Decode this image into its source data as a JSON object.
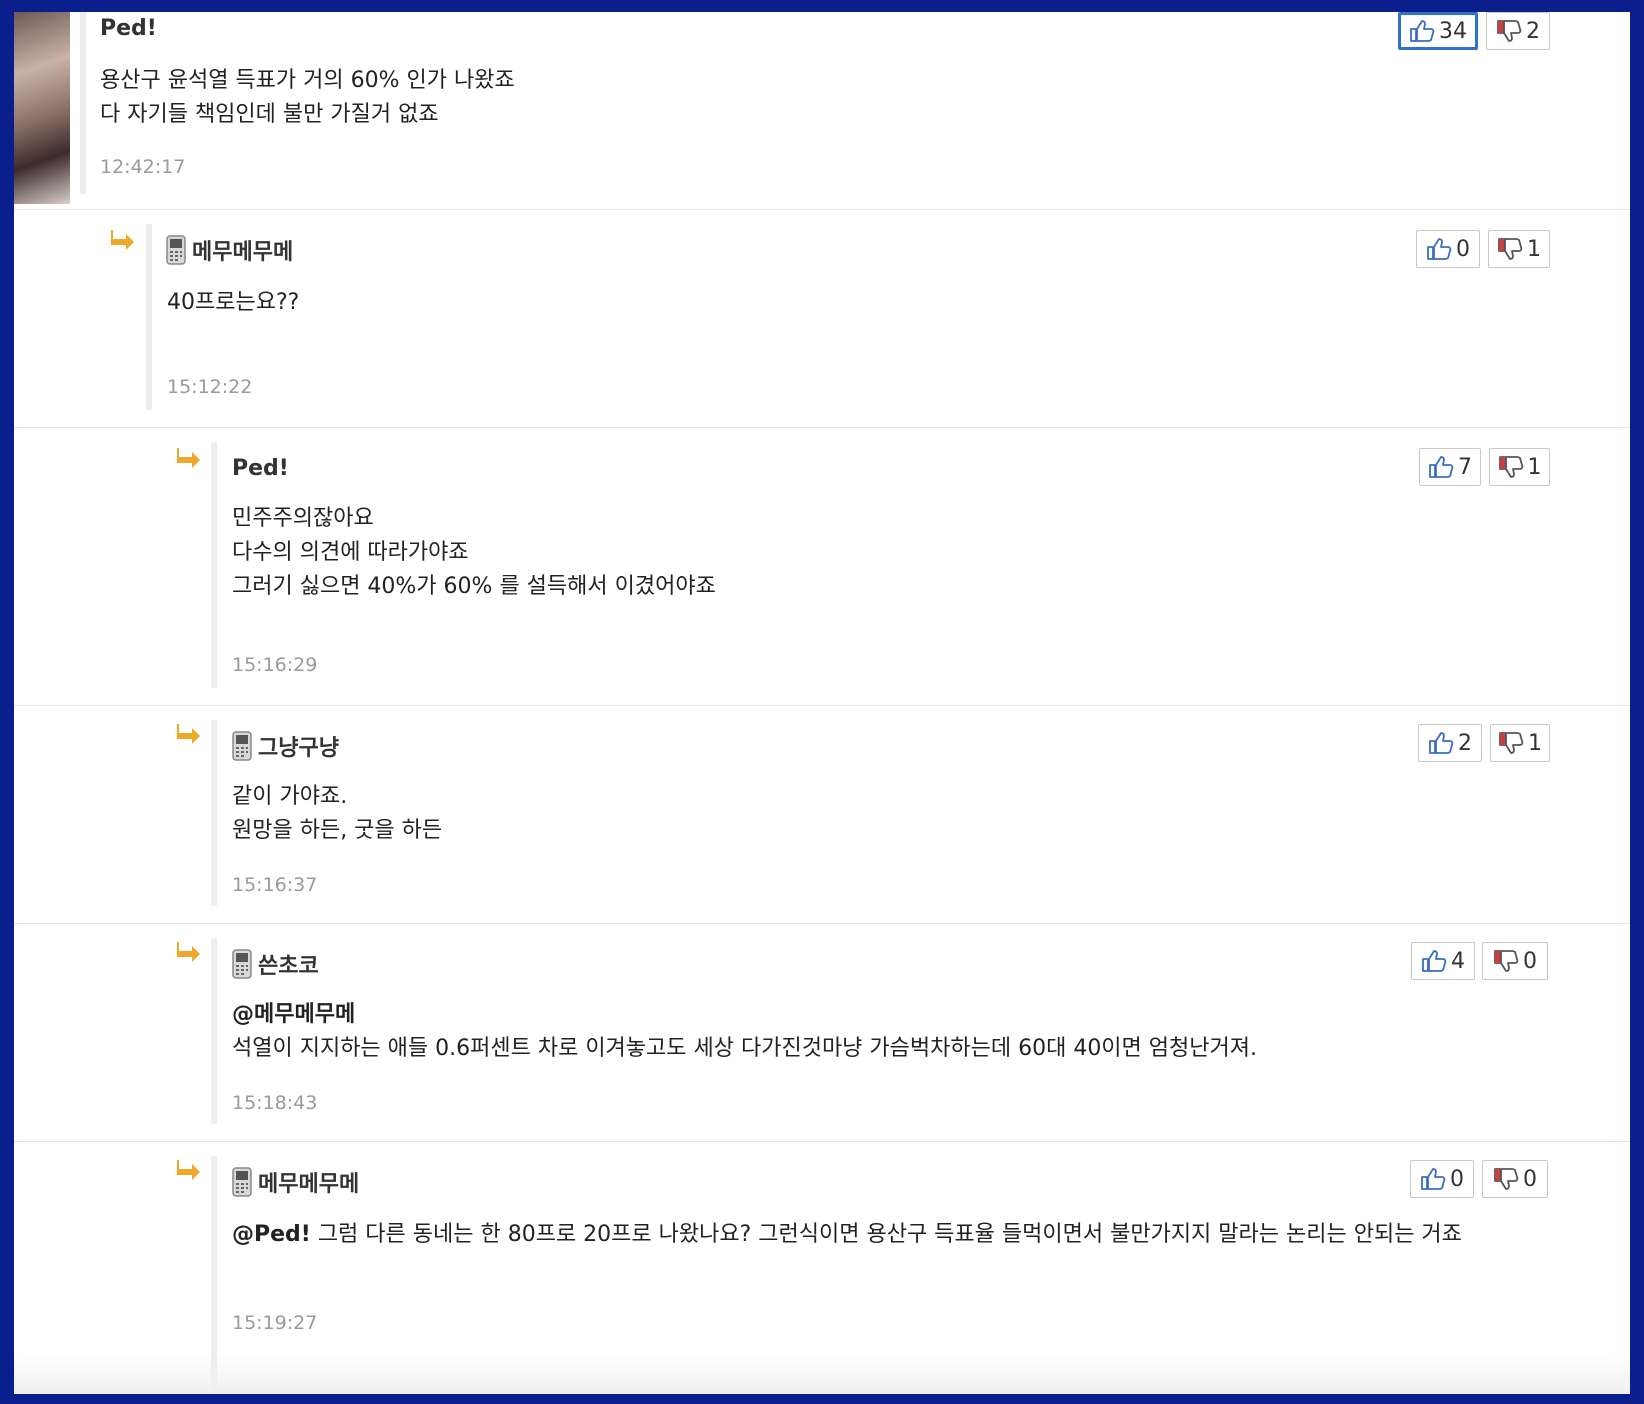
{
  "comments": [
    {
      "author": "Ped!",
      "lines": [
        "용산구 윤석열 득표가 거의 60% 인가 나왔죠",
        "다 자기들 책임인데 불만 가질거 없죠"
      ],
      "time": "12:42:17",
      "up": "34",
      "down": "2"
    },
    {
      "author": "메무메무메",
      "lines": [
        "40프로는요??"
      ],
      "time": "15:12:22",
      "up": "0",
      "down": "1"
    },
    {
      "author": "Ped!",
      "lines": [
        "민주주의잖아요",
        "다수의 의견에 따라가야죠",
        "그러기 싫으면 40%가 60% 를 설득해서 이겼어야죠"
      ],
      "time": "15:16:29",
      "up": "7",
      "down": "1"
    },
    {
      "author": "그냥구냥",
      "lines": [
        "같이 가야죠.",
        "원망을 하든, 굿을 하든"
      ],
      "time": "15:16:37",
      "up": "2",
      "down": "1"
    },
    {
      "author": "쓴초코",
      "mention": "@메무메무메",
      "lines": [
        "석열이 지지하는 애들 0.6퍼센트 차로 이겨놓고도 세상 다가진것마냥 가슴벅차하는데 60대 40이면 엄청난거져."
      ],
      "time": "15:18:43",
      "up": "4",
      "down": "0"
    },
    {
      "author": "메무메무메",
      "mention": "@Ped!",
      "lines": [
        " 그럼 다른 동네는 한 80프로 20프로 나왔나요? 그런식이면 용산구 득표율 들먹이면서 불만가지지 말라는 논리는 안되는 거죠"
      ],
      "time": "15:19:27",
      "up": "0",
      "down": "0"
    }
  ],
  "icons": {
    "reply": "reply-arrow-icon",
    "mobile": "mobile-phone-icon",
    "up": "thumbs-up-icon",
    "down": "thumbs-down-icon"
  },
  "colors": {
    "outer_border": "#0b1f8c",
    "reply_arrow": "#f0a82a",
    "active_vote_border": "#2e73c9"
  }
}
